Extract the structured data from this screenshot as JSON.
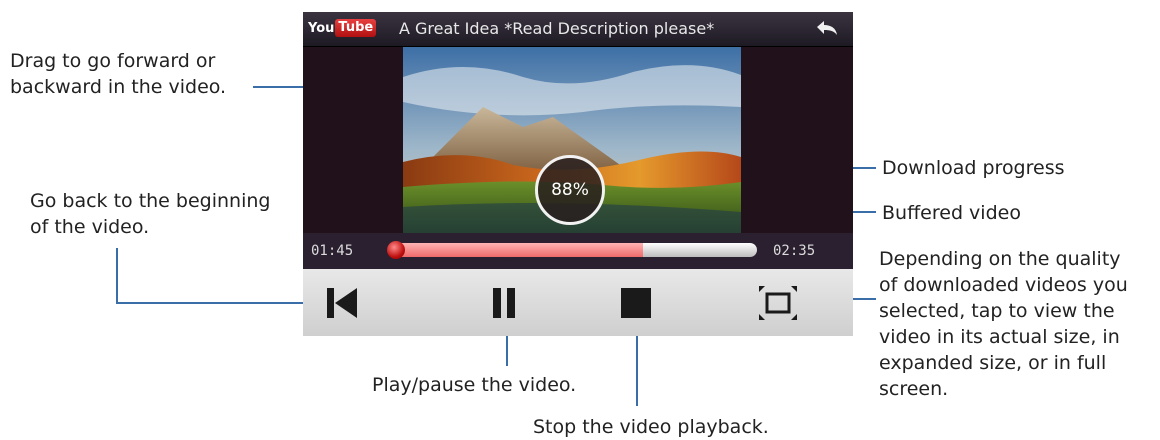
{
  "player": {
    "logo_you": "You",
    "logo_tube": "Tube",
    "title": "A Great Idea *Read Description please*",
    "download_progress": "88%",
    "time_elapsed": "01:45",
    "time_total": "02:35",
    "buffered_fraction": 0.69,
    "played_fraction": 0.0,
    "accent_color": "#e84545",
    "icons": [
      "back-arrow-icon",
      "skip-to-start-icon",
      "pause-icon",
      "stop-icon",
      "fullscreen-icon"
    ]
  },
  "callouts": {
    "drag_line1": "Drag to go forward or",
    "drag_line2": "backward in the video.",
    "beginning_line1": "Go back to the beginning",
    "beginning_line2": "of the video.",
    "download": "Download progress",
    "buffered": "Buffered video",
    "quality_line1": "Depending on the quality",
    "quality_line2": "of downloaded videos you",
    "quality_line3": "selected, tap to view the",
    "quality_line4": "video in its actual size, in",
    "quality_line5": "expanded size, or in full",
    "quality_line6": "screen.",
    "play_pause": "Play/pause the video.",
    "stop": "Stop the video playback."
  }
}
